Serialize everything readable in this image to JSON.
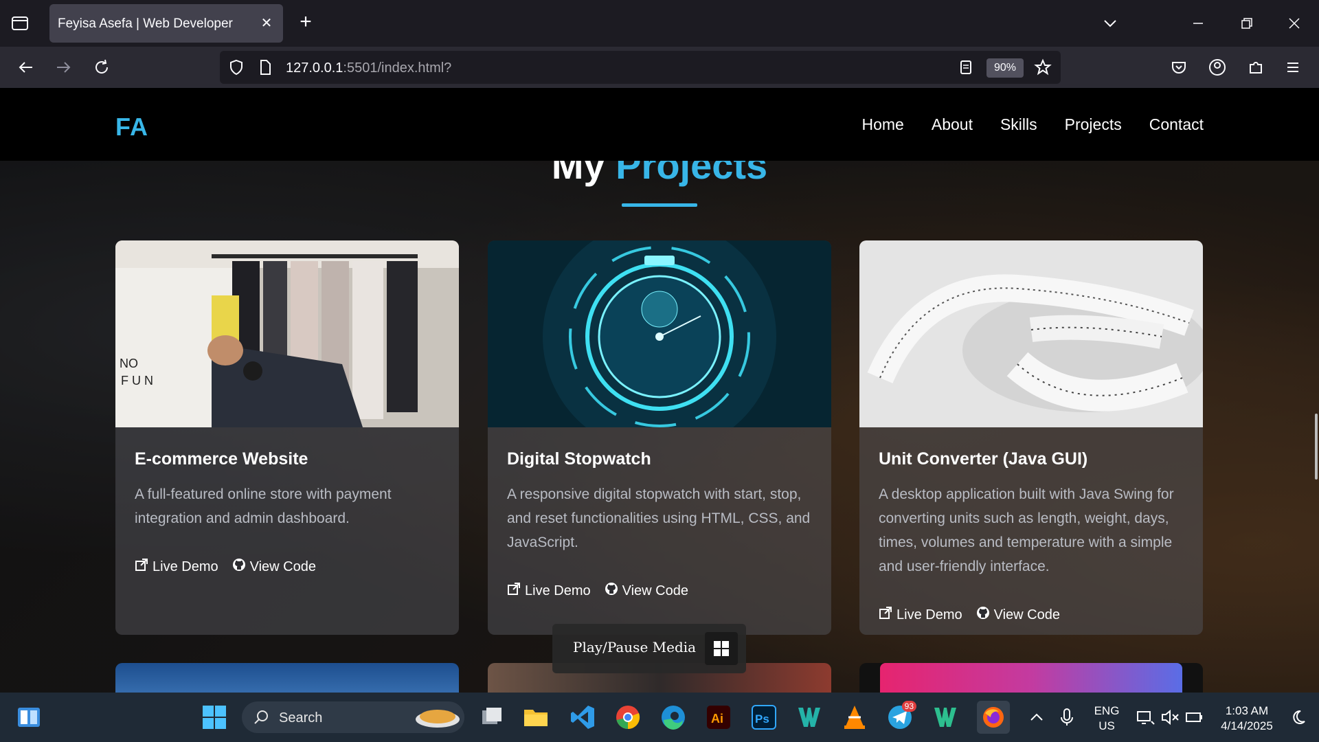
{
  "browser": {
    "tab_title": "Feyisa Asefa | Web Developer",
    "url_host": "127.0.0.1",
    "url_rest": ":5501/index.html?",
    "zoom": "90%"
  },
  "site": {
    "logo": "FA",
    "menu": [
      "Home",
      "About",
      "Skills",
      "Projects",
      "Contact"
    ],
    "section_title_plain": "My",
    "section_title_accent": "Projects"
  },
  "projects": [
    {
      "title": "E-commerce Website",
      "desc": "A full-featured online store with payment integration and admin dashboard.",
      "live": "Live Demo",
      "code": "View Code"
    },
    {
      "title": "Digital Stopwatch",
      "desc": "A responsive digital stopwatch with start, stop, and reset functionalities using HTML, CSS, and JavaScript.",
      "live": "Live Demo",
      "code": "View Code"
    },
    {
      "title": "Unit Converter (Java GUI)",
      "desc": "A desktop application built with Java Swing for converting units such as length, weight, days, times, volumes and temperature with a simple and user-friendly interface.",
      "live": "Live Demo",
      "code": "View Code"
    }
  ],
  "overlay": {
    "media_label": "Play/Pause Media"
  },
  "taskbar": {
    "search_label": "Search",
    "telegram_badge": "93",
    "lang_top": "ENG",
    "lang_bottom": "US",
    "time": "1:03 AM",
    "date": "4/14/2025"
  },
  "colors": {
    "accent": "#38b6e8",
    "header_bg": "#000000",
    "card_bg": "rgba(80,80,85,0.55)"
  }
}
